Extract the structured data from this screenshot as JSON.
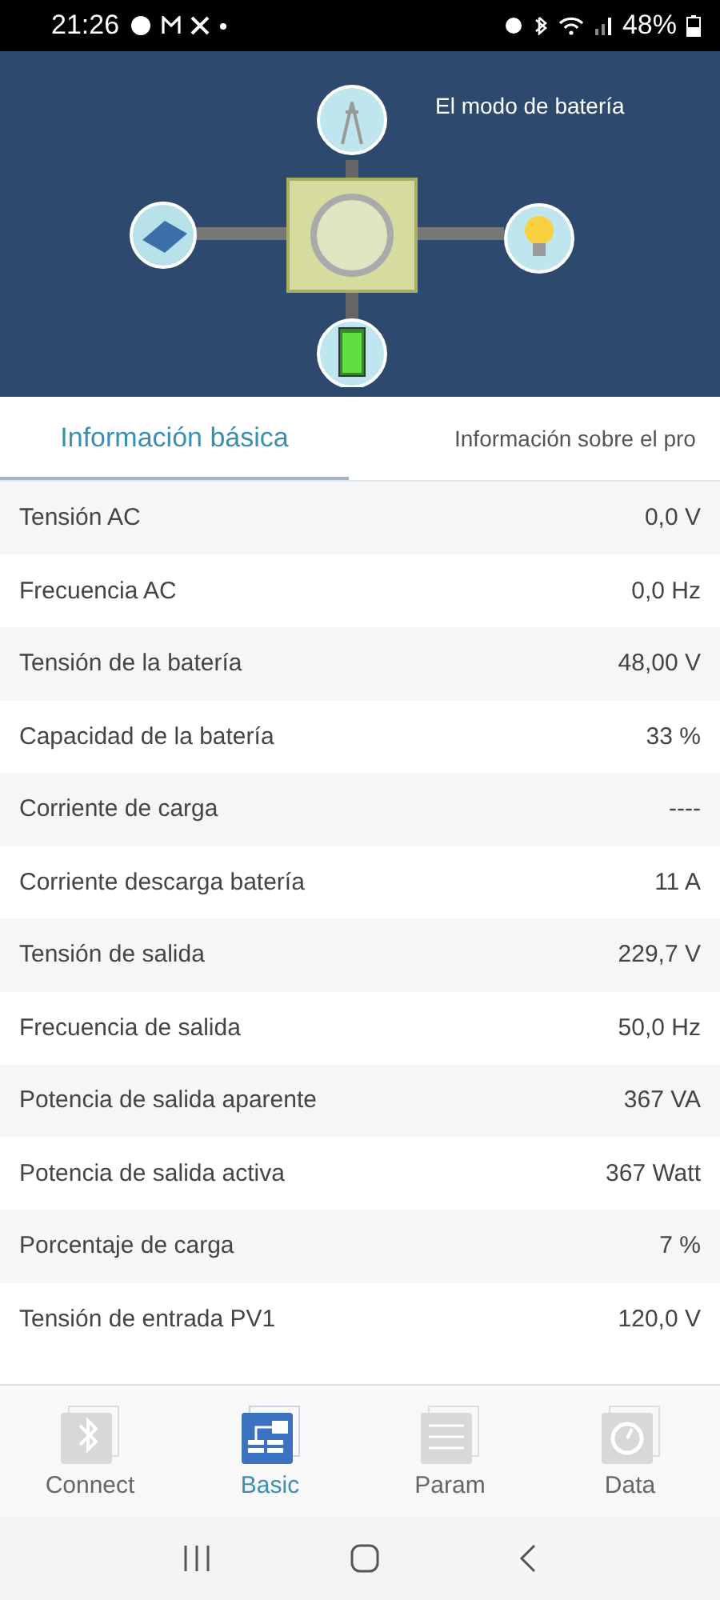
{
  "status_bar": {
    "time": "21:26",
    "battery": "48%"
  },
  "header": {
    "mode": "El modo de batería"
  },
  "tabs": [
    {
      "label": "Información básica",
      "selected": true
    },
    {
      "label": "Información sobre el pro",
      "selected": false
    }
  ],
  "rows": [
    {
      "label": "Tensión AC",
      "value": "0,0 V"
    },
    {
      "label": "Frecuencia AC",
      "value": "0,0 Hz"
    },
    {
      "label": "Tensión de la batería",
      "value": "48,00 V"
    },
    {
      "label": "Capacidad de la batería",
      "value": "33 %"
    },
    {
      "label": "Corriente de carga",
      "value": "----"
    },
    {
      "label": "Corriente descarga batería",
      "value": "11 A"
    },
    {
      "label": "Tensión de salida",
      "value": "229,7 V"
    },
    {
      "label": "Frecuencia de salida",
      "value": "50,0 Hz"
    },
    {
      "label": "Potencia de salida aparente",
      "value": "367 VA"
    },
    {
      "label": "Potencia de salida activa",
      "value": "367 Watt"
    },
    {
      "label": "Porcentaje de carga",
      "value": "7 %"
    },
    {
      "label": "Tensión de entrada PV1",
      "value": "120,0 V"
    }
  ],
  "bottom_nav": [
    {
      "label": "Connect",
      "kind": "bluetooth",
      "selected": false
    },
    {
      "label": "Basic",
      "kind": "basic",
      "selected": true
    },
    {
      "label": "Param",
      "kind": "param",
      "selected": false
    },
    {
      "label": "Data",
      "kind": "data",
      "selected": false
    }
  ]
}
